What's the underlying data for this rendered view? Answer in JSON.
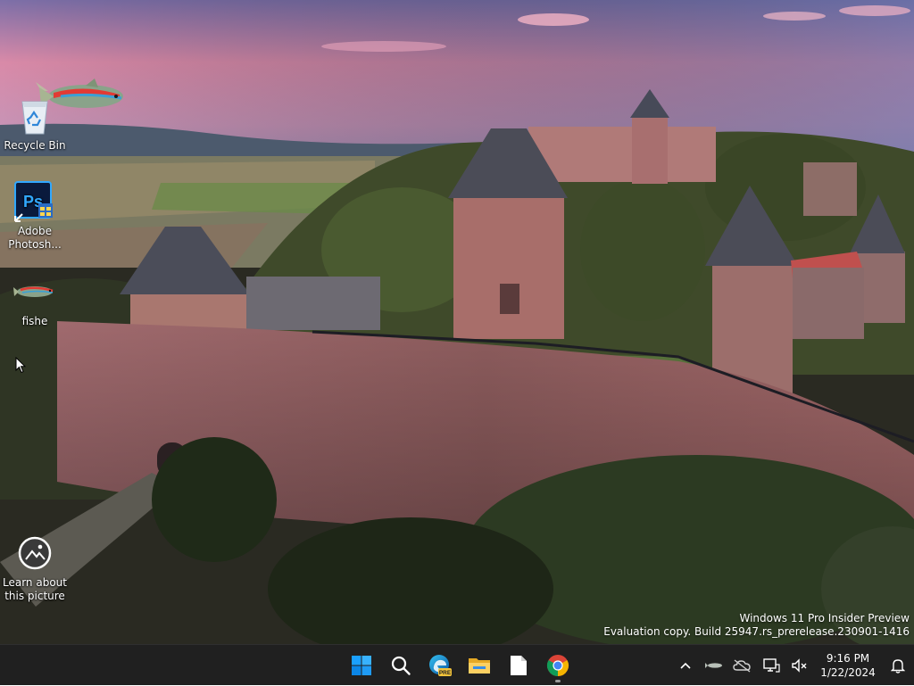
{
  "desktop": {
    "icons": [
      {
        "name": "recycle-bin",
        "label": "Recycle Bin"
      },
      {
        "name": "adobe-photoshop",
        "label": "Adobe Photosh..."
      },
      {
        "name": "fishe",
        "label": "fishe"
      },
      {
        "name": "learn-about-picture",
        "label": "Learn about this picture"
      }
    ],
    "watermark": {
      "line1": "Windows 11 Pro Insider Preview",
      "line2": "Evaluation copy. Build 25947.rs_prerelease.230901-1416"
    },
    "ps_badge": "Ps"
  },
  "taskbar": {
    "apps": [
      "start-icon",
      "search-icon",
      "edge-beta-icon",
      "file-explorer-icon",
      "notepad-icon",
      "chrome-icon"
    ],
    "edge_badge": "PRE",
    "clock": {
      "time": "9:16 PM",
      "date": "1/22/2024"
    },
    "tray": [
      "chevron-up-icon",
      "fish-tray-icon",
      "onedrive-icon",
      "network-icon",
      "volume-mute-icon",
      "notification-bell-icon"
    ]
  },
  "colors": {
    "taskbar_bg": "#202020",
    "accent_blue": "#0078d4",
    "sky_pink": "#d98aa8",
    "sky_blue": "#5b6fa6"
  }
}
